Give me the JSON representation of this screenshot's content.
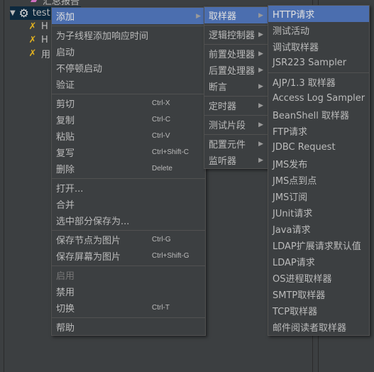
{
  "tree": {
    "items": [
      {
        "label": "汇总报告",
        "icon": "report-icon"
      },
      {
        "label": "test",
        "icon": "thread-group-gear-icon",
        "selected": true
      },
      {
        "label": "H",
        "icon": "wrench-icon"
      },
      {
        "label": "H",
        "icon": "wrench-icon"
      },
      {
        "label": "用",
        "icon": "wrench-icon"
      }
    ]
  },
  "context_menu": {
    "items": [
      {
        "label": "添加",
        "submenu": true,
        "highlighted": true
      },
      {
        "sep": true
      },
      {
        "label": "为子线程添加响应时间"
      },
      {
        "label": "启动"
      },
      {
        "label": "不停顿启动"
      },
      {
        "label": "验证"
      },
      {
        "sep": true
      },
      {
        "label": "剪切",
        "shortcut": "Ctrl-X"
      },
      {
        "label": "复制",
        "shortcut": "Ctrl-C"
      },
      {
        "label": "粘贴",
        "shortcut": "Ctrl-V"
      },
      {
        "label": "复写",
        "shortcut": "Ctrl+Shift-C"
      },
      {
        "label": "删除",
        "shortcut": "Delete"
      },
      {
        "sep": true
      },
      {
        "label": "打开..."
      },
      {
        "label": "合并"
      },
      {
        "label": "选中部分保存为..."
      },
      {
        "sep": true
      },
      {
        "label": "保存节点为图片",
        "shortcut": "Ctrl-G"
      },
      {
        "label": "保存屏幕为图片",
        "shortcut": "Ctrl+Shift-G"
      },
      {
        "sep": true
      },
      {
        "label": "启用",
        "disabled": true
      },
      {
        "label": "禁用"
      },
      {
        "label": "切换",
        "shortcut": "Ctrl-T"
      },
      {
        "sep": true
      },
      {
        "label": "帮助"
      }
    ]
  },
  "add_submenu": {
    "items": [
      {
        "label": "取样器",
        "submenu": true,
        "highlighted": true
      },
      {
        "sep": true
      },
      {
        "label": "逻辑控制器",
        "submenu": true
      },
      {
        "sep": true
      },
      {
        "label": "前置处理器",
        "submenu": true
      },
      {
        "label": "后置处理器",
        "submenu": true
      },
      {
        "label": "断言",
        "submenu": true
      },
      {
        "sep": true
      },
      {
        "label": "定时器",
        "submenu": true
      },
      {
        "sep": true
      },
      {
        "label": "测试片段",
        "submenu": true
      },
      {
        "sep": true
      },
      {
        "label": "配置元件",
        "submenu": true
      },
      {
        "label": "监听器",
        "submenu": true
      }
    ]
  },
  "sampler_submenu": {
    "items": [
      {
        "label": "HTTP请求",
        "highlighted": true
      },
      {
        "label": "测试活动"
      },
      {
        "label": "调试取样器"
      },
      {
        "label": "JSR223 Sampler"
      },
      {
        "sep": true
      },
      {
        "label": "AJP/1.3 取样器"
      },
      {
        "label": "Access Log Sampler"
      },
      {
        "label": "BeanShell 取样器"
      },
      {
        "label": "FTP请求"
      },
      {
        "label": "JDBC Request"
      },
      {
        "label": "JMS发布"
      },
      {
        "label": "JMS点到点"
      },
      {
        "label": "JMS订阅"
      },
      {
        "label": "JUnit请求"
      },
      {
        "label": "Java请求"
      },
      {
        "label": "LDAP扩展请求默认值"
      },
      {
        "label": "LDAP请求"
      },
      {
        "label": "OS进程取样器"
      },
      {
        "label": "SMTP取样器"
      },
      {
        "label": "TCP取样器"
      },
      {
        "label": "邮件阅读者取样器"
      }
    ]
  },
  "colors": {
    "background": "#3c3f41",
    "highlight": "#4b6eaf",
    "text": "#bbbbbb",
    "tree_selection": "#0d293e"
  }
}
